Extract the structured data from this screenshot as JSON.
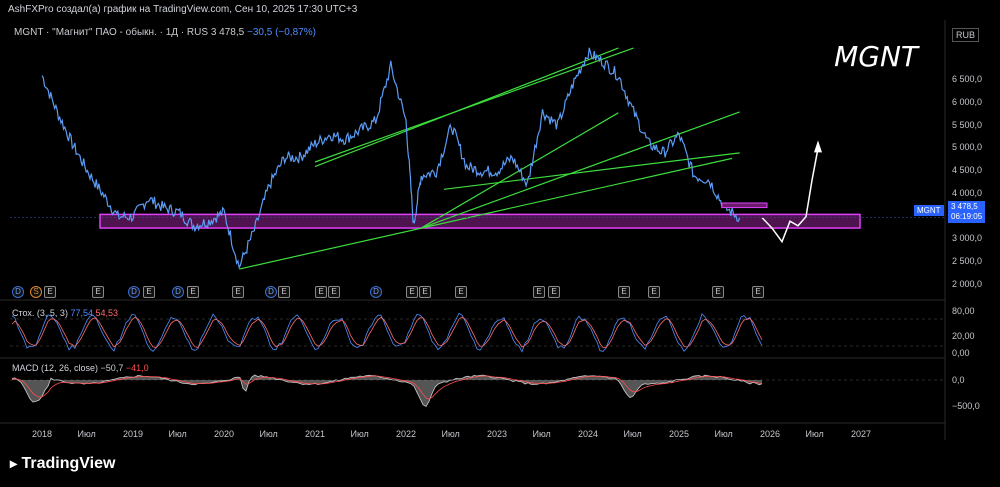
{
  "header": {
    "attribution": "AshFXPro создал(а) график на TradingView.com, Сен 10, 2025 17:30 UTC+3"
  },
  "legend": {
    "symbol_desc": "MGNT · \"Магнит\" ПАО - обыкн. · 1Д · RUS",
    "price": "3 478,5",
    "change": "−30,5 (−0,87%)"
  },
  "ticker_watermark": "MGNT",
  "currency": "RUB",
  "price_label": {
    "symbol": "MGNT",
    "price": "3 478,5",
    "countdown": "06:19:05"
  },
  "price_axis_labels": [
    "6 500,0",
    "6 000,0",
    "5 500,0",
    "5 000,0",
    "4 500,0",
    "4 000,0",
    "3 000,0",
    "2 500,0",
    "2 000,0"
  ],
  "time_axis_labels": [
    "2018",
    "Июл",
    "2019",
    "Июл",
    "2020",
    "Июл",
    "2021",
    "Июл",
    "2022",
    "Июл",
    "2023",
    "Июл",
    "2024",
    "Июл",
    "2025",
    "Июл",
    "2026",
    "Июл",
    "2027"
  ],
  "events": [
    "D",
    "S",
    "E",
    "E",
    "D",
    "E",
    "D",
    "E",
    "E",
    "D",
    "E",
    "E",
    "E",
    "D",
    "E",
    "E",
    "E",
    "E",
    "E",
    "E",
    "E",
    "E",
    "E"
  ],
  "stoch": {
    "title": "Стох. (3, 5, 3)",
    "k": "77,54",
    "d": "54,53",
    "levels": [
      "80,00",
      "20,00",
      "0,00"
    ],
    "colors": {
      "k": "#4f8dff",
      "d": "#ff6d6d"
    }
  },
  "macd": {
    "title": "MACD (12, 26, close)",
    "macd": "−50,7",
    "signal": "−41,0",
    "levels": [
      "0,0",
      "−500,0"
    ],
    "colors": {
      "macd": "#c9cbd1",
      "signal": "#ff4d4d"
    }
  },
  "footer": {
    "brand": "TradingView"
  },
  "colors": {
    "price_line": "#5b9cf6",
    "trendline": "#3ddc3d",
    "zone_fill": "#6a1b6a",
    "zone_border": "#e040fb",
    "projection": "#ffffff",
    "background": "#000000"
  },
  "chart_data": {
    "type": "line",
    "title": "MGNT",
    "ylabel": "RUB",
    "ylim": [
      1800,
      7000
    ],
    "x": [
      "2018-01",
      "2018-03",
      "2018-05",
      "2018-07",
      "2018-09",
      "2018-11",
      "2019-01",
      "2019-03",
      "2019-05",
      "2019-07",
      "2019-09",
      "2019-11",
      "2020-01",
      "2020-03",
      "2020-05",
      "2020-07",
      "2020-09",
      "2020-11",
      "2021-01",
      "2021-03",
      "2021-05",
      "2021-07",
      "2021-09",
      "2021-11",
      "2022-01",
      "2022-02",
      "2022-03",
      "2022-05",
      "2022-07",
      "2022-09",
      "2022-11",
      "2023-01",
      "2023-03",
      "2023-05",
      "2023-07",
      "2023-09",
      "2023-11",
      "2024-01",
      "2024-03",
      "2024-05",
      "2024-07",
      "2024-09",
      "2024-11",
      "2025-01",
      "2025-03",
      "2025-05",
      "2025-07",
      "2025-09"
    ],
    "series": [
      {
        "values": [
          6600,
          5800,
          5100,
          4500,
          4000,
          3500,
          3500,
          3900,
          3700,
          3600,
          3300,
          3400,
          3600,
          2400,
          3200,
          4200,
          4800,
          4800,
          5100,
          5300,
          5200,
          5400,
          5600,
          6800,
          5600,
          3300,
          4400,
          4500,
          5500,
          4600,
          4500,
          4500,
          4800,
          4200,
          5800,
          5500,
          6400,
          7100,
          6900,
          6600,
          5800,
          5100,
          4900,
          5300,
          4400,
          4300,
          3700,
          3480
        ]
      }
    ],
    "zone": {
      "low": 3250,
      "high": 3550
    },
    "projection": [
      3480,
      3250,
      2950,
      3400,
      3300,
      3500,
      4300,
      5000
    ]
  }
}
